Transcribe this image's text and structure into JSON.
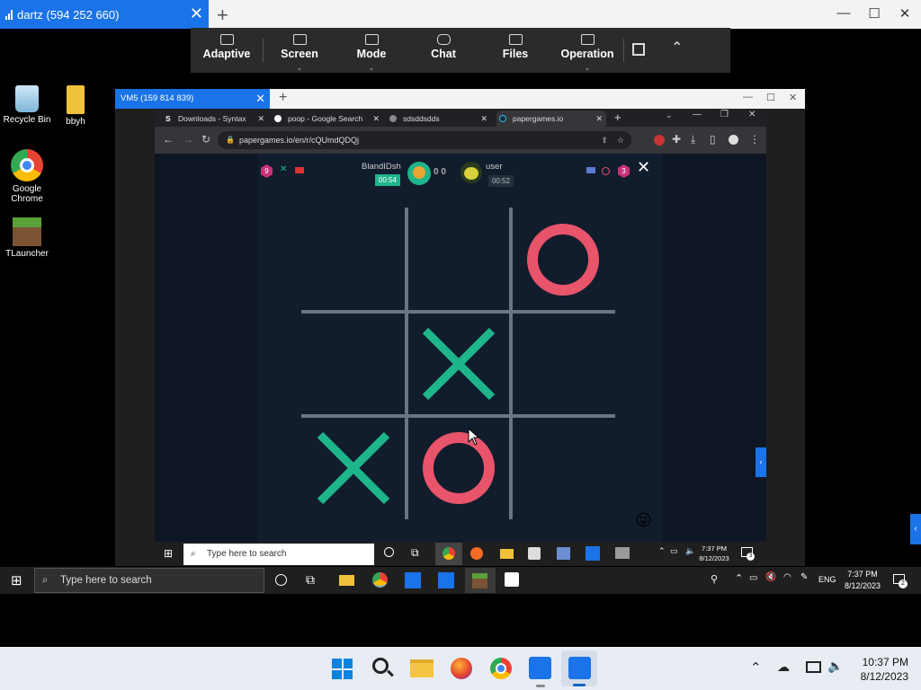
{
  "client": {
    "session_tab": "dartz (594 252 660)",
    "toolbar": [
      {
        "label": "Adaptive",
        "icon": "adaptive-icon",
        "caret": false
      },
      {
        "label": "Screen",
        "icon": "screen-icon",
        "caret": true
      },
      {
        "label": "Mode",
        "icon": "mode-icon",
        "caret": true
      },
      {
        "label": "Chat",
        "icon": "chat-icon",
        "caret": false
      },
      {
        "label": "Files",
        "icon": "files-icon",
        "caret": false
      },
      {
        "label": "Operation",
        "icon": "operation-icon",
        "caret": true
      }
    ]
  },
  "desktop": {
    "icons": [
      {
        "label": "Recycle Bin",
        "icon": "recycle-bin-icon"
      },
      {
        "label": "bbyh",
        "icon": "folder-icon"
      },
      {
        "label": "Google Chrome",
        "icon": "chrome-icon"
      },
      {
        "label": "TLauncher",
        "icon": "tlauncher-icon"
      }
    ]
  },
  "vm": {
    "session_tab": "VM5 (159 814 839)",
    "browser": {
      "tabs": [
        {
          "title": "Downloads - Syntax",
          "favicon": "S"
        },
        {
          "title": "poop - Google Search",
          "favicon": "G"
        },
        {
          "title": "sdsddsdds",
          "favicon": ""
        },
        {
          "title": "papergames.io",
          "favicon": ""
        }
      ],
      "url": "papergames.io/en/r/cQUmdQDQj"
    },
    "game": {
      "player1": {
        "name": "BlandIDsh",
        "timer": "00:54",
        "level": "9"
      },
      "player2": {
        "name": "user",
        "timer": "00:52",
        "level": "3"
      },
      "score": "0 0",
      "board": [
        "",
        "",
        "O",
        "",
        "X",
        "",
        "X",
        "O",
        ""
      ],
      "x_color": "#1fb58b",
      "o_color": "#e8546a"
    },
    "taskbar": {
      "search_placeholder": "Type here to search",
      "time": "7:37 PM",
      "date": "8/12/2023",
      "notification_count": "3"
    }
  },
  "host_taskbar": {
    "search_placeholder": "Type here to search",
    "language": "ENG",
    "time": "7:37 PM",
    "date": "8/12/2023",
    "notification_count": "2"
  },
  "win11_taskbar": {
    "time": "10:37 PM",
    "date": "8/12/2023"
  }
}
